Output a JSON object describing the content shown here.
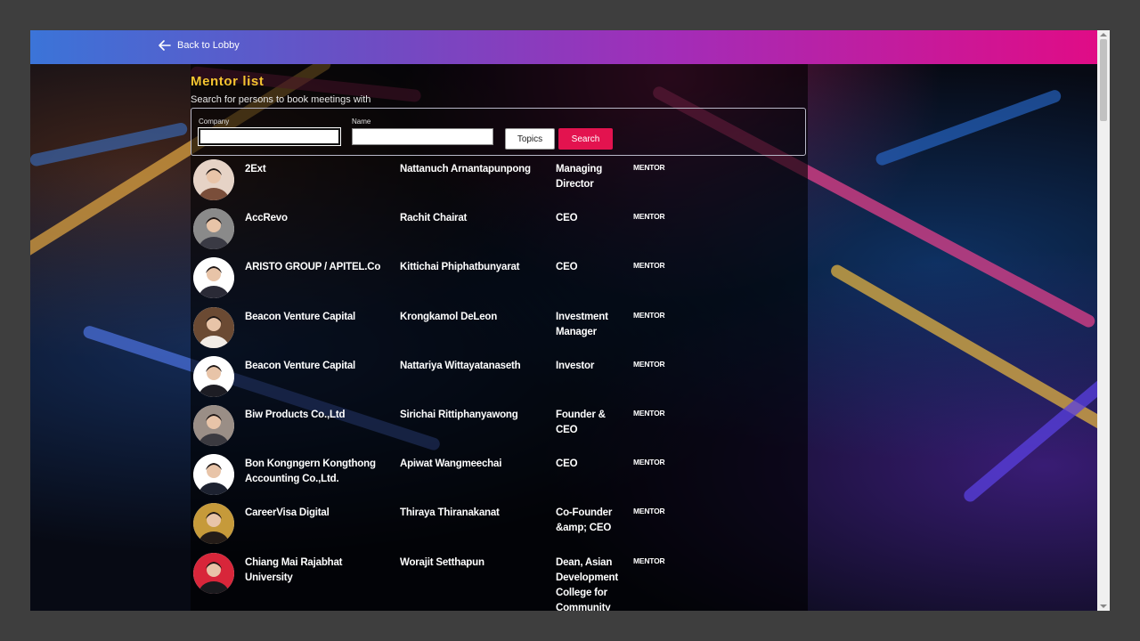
{
  "header": {
    "back_label": "Back to Lobby"
  },
  "page": {
    "title": "Mentor list",
    "subtitle": "Search for persons to book meetings with"
  },
  "search": {
    "company_label": "Company",
    "company_value": "",
    "name_label": "Name",
    "name_value": "",
    "topics_label": "Topics",
    "search_label": "Search"
  },
  "mentors": [
    {
      "company": "2Ext",
      "name": "Nattanuch Arnantapunpong",
      "title": "Managing Director",
      "role": "MENTOR",
      "avatar_bg": "#e6d3c6",
      "avatar_fg": "#7a4e3a"
    },
    {
      "company": "AccRevo",
      "name": "Rachit Chairat",
      "title": "CEO",
      "role": "MENTOR",
      "avatar_bg": "#8a8a8a",
      "avatar_fg": "#3a3a44"
    },
    {
      "company": "ARISTO GROUP / APITEL.Co",
      "name": "Kittichai Phiphatbunyarat",
      "title": "CEO",
      "role": "MENTOR",
      "avatar_bg": "#ffffff",
      "avatar_fg": "#2a2a36"
    },
    {
      "company": "Beacon Venture Capital",
      "name": "Krongkamol DeLeon",
      "title": "Investment Manager",
      "role": "MENTOR",
      "avatar_bg": "#6b4a33",
      "avatar_fg": "#f2ece6"
    },
    {
      "company": "Beacon Venture Capital",
      "name": "Nattariya Wittayatanaseth",
      "title": "Investor",
      "role": "MENTOR",
      "avatar_bg": "#ffffff",
      "avatar_fg": "#1d1d24"
    },
    {
      "company": "Biw Products Co.,Ltd",
      "name": "Sirichai Rittiphanyawong",
      "title": "Founder & CEO",
      "role": "MENTOR",
      "avatar_bg": "#9a8e86",
      "avatar_fg": "#3b3a40"
    },
    {
      "company": "Bon Kongngern Kongthong Accounting Co.,Ltd.",
      "name": "Apiwat Wangmeechai",
      "title": "CEO",
      "role": "MENTOR",
      "avatar_bg": "#ffffff",
      "avatar_fg": "#1d2230"
    },
    {
      "company": "CareerVisa Digital",
      "name": "Thiraya Thiranakanat",
      "title": "Co-Founder &amp; CEO",
      "role": "MENTOR",
      "avatar_bg": "#c69a3a",
      "avatar_fg": "#241c18"
    },
    {
      "company": "Chiang Mai Rajabhat University",
      "name": "Worajit Setthapun",
      "title": "Dean, Asian Development College for Community",
      "role": "MENTOR",
      "avatar_bg": "#d8263a",
      "avatar_fg": "#1a1a1e"
    }
  ]
}
